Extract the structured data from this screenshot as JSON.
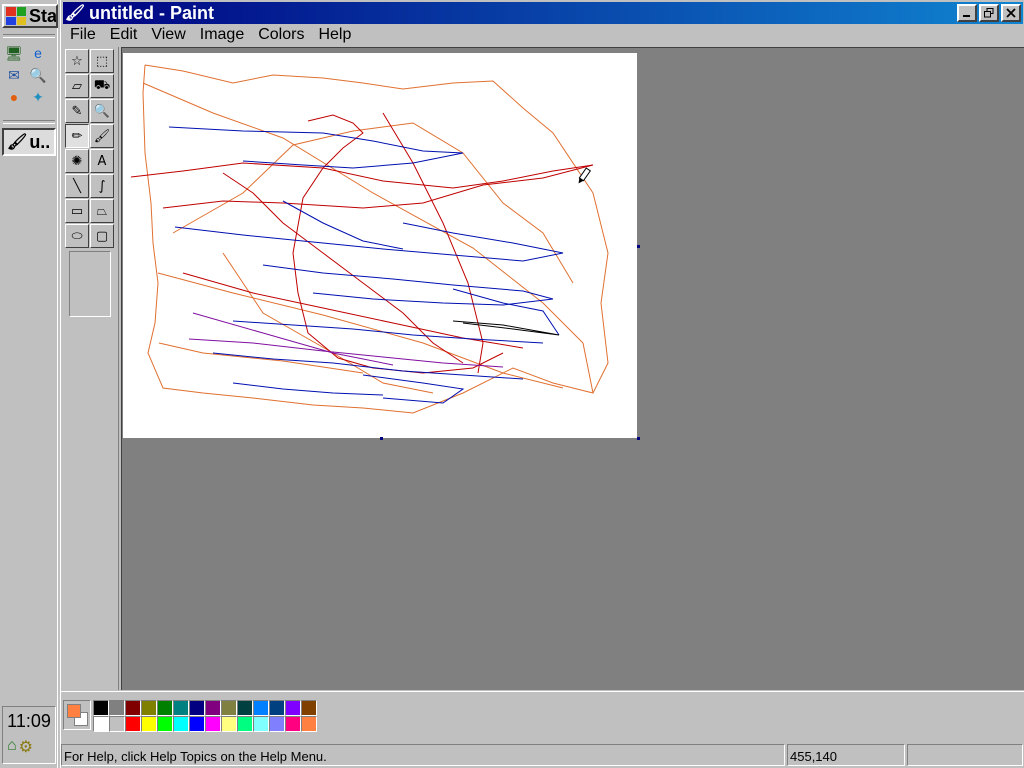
{
  "taskbar": {
    "start_label": "Sta",
    "quick_launch": [
      {
        "name": "desktop-icon",
        "glyph": "🖥"
      },
      {
        "name": "ie-icon",
        "glyph": "e"
      },
      {
        "name": "outlook-icon",
        "glyph": "✉"
      },
      {
        "name": "search-icon",
        "glyph": "🔍"
      },
      {
        "name": "firefox-icon",
        "glyph": "●"
      },
      {
        "name": "messenger-icon",
        "glyph": "✦"
      }
    ],
    "task_label": "u..",
    "clock": "11:09"
  },
  "window": {
    "title": "untitled - Paint",
    "menu": [
      "File",
      "Edit",
      "View",
      "Image",
      "Colors",
      "Help"
    ]
  },
  "tools": [
    {
      "name": "free-select-tool",
      "glyph": "☆"
    },
    {
      "name": "rect-select-tool",
      "glyph": "⬚"
    },
    {
      "name": "eraser-tool",
      "glyph": "▱"
    },
    {
      "name": "fill-tool",
      "glyph": "⛟"
    },
    {
      "name": "color-picker-tool",
      "glyph": "✎"
    },
    {
      "name": "magnifier-tool",
      "glyph": "🔍"
    },
    {
      "name": "pencil-tool",
      "glyph": "✏"
    },
    {
      "name": "brush-tool",
      "glyph": "🖌"
    },
    {
      "name": "airbrush-tool",
      "glyph": "✺"
    },
    {
      "name": "text-tool",
      "glyph": "A"
    },
    {
      "name": "line-tool",
      "glyph": "╲"
    },
    {
      "name": "curve-tool",
      "glyph": "∫"
    },
    {
      "name": "rectangle-tool",
      "glyph": "▭"
    },
    {
      "name": "polygon-tool",
      "glyph": "⏢"
    },
    {
      "name": "ellipse-tool",
      "glyph": "⬭"
    },
    {
      "name": "rounded-rect-tool",
      "glyph": "▢"
    }
  ],
  "active_tool": "pencil-tool",
  "colors": {
    "foreground": "#ff8040",
    "background": "#ffffff",
    "palette_top": [
      "#000000",
      "#808080",
      "#800000",
      "#808000",
      "#008000",
      "#008080",
      "#000080",
      "#800080",
      "#808040",
      "#004040",
      "#0080ff",
      "#004080",
      "#8000ff",
      "#804000"
    ],
    "palette_bottom": [
      "#ffffff",
      "#c0c0c0",
      "#ff0000",
      "#ffff00",
      "#00ff00",
      "#00ffff",
      "#0000ff",
      "#ff00ff",
      "#ffff80",
      "#00ff80",
      "#80ffff",
      "#8080ff",
      "#ff0080",
      "#ff8040"
    ]
  },
  "status": {
    "help_text": "For Help, click Help Topics on the Help Menu.",
    "coords": "455,140",
    "size": ""
  }
}
